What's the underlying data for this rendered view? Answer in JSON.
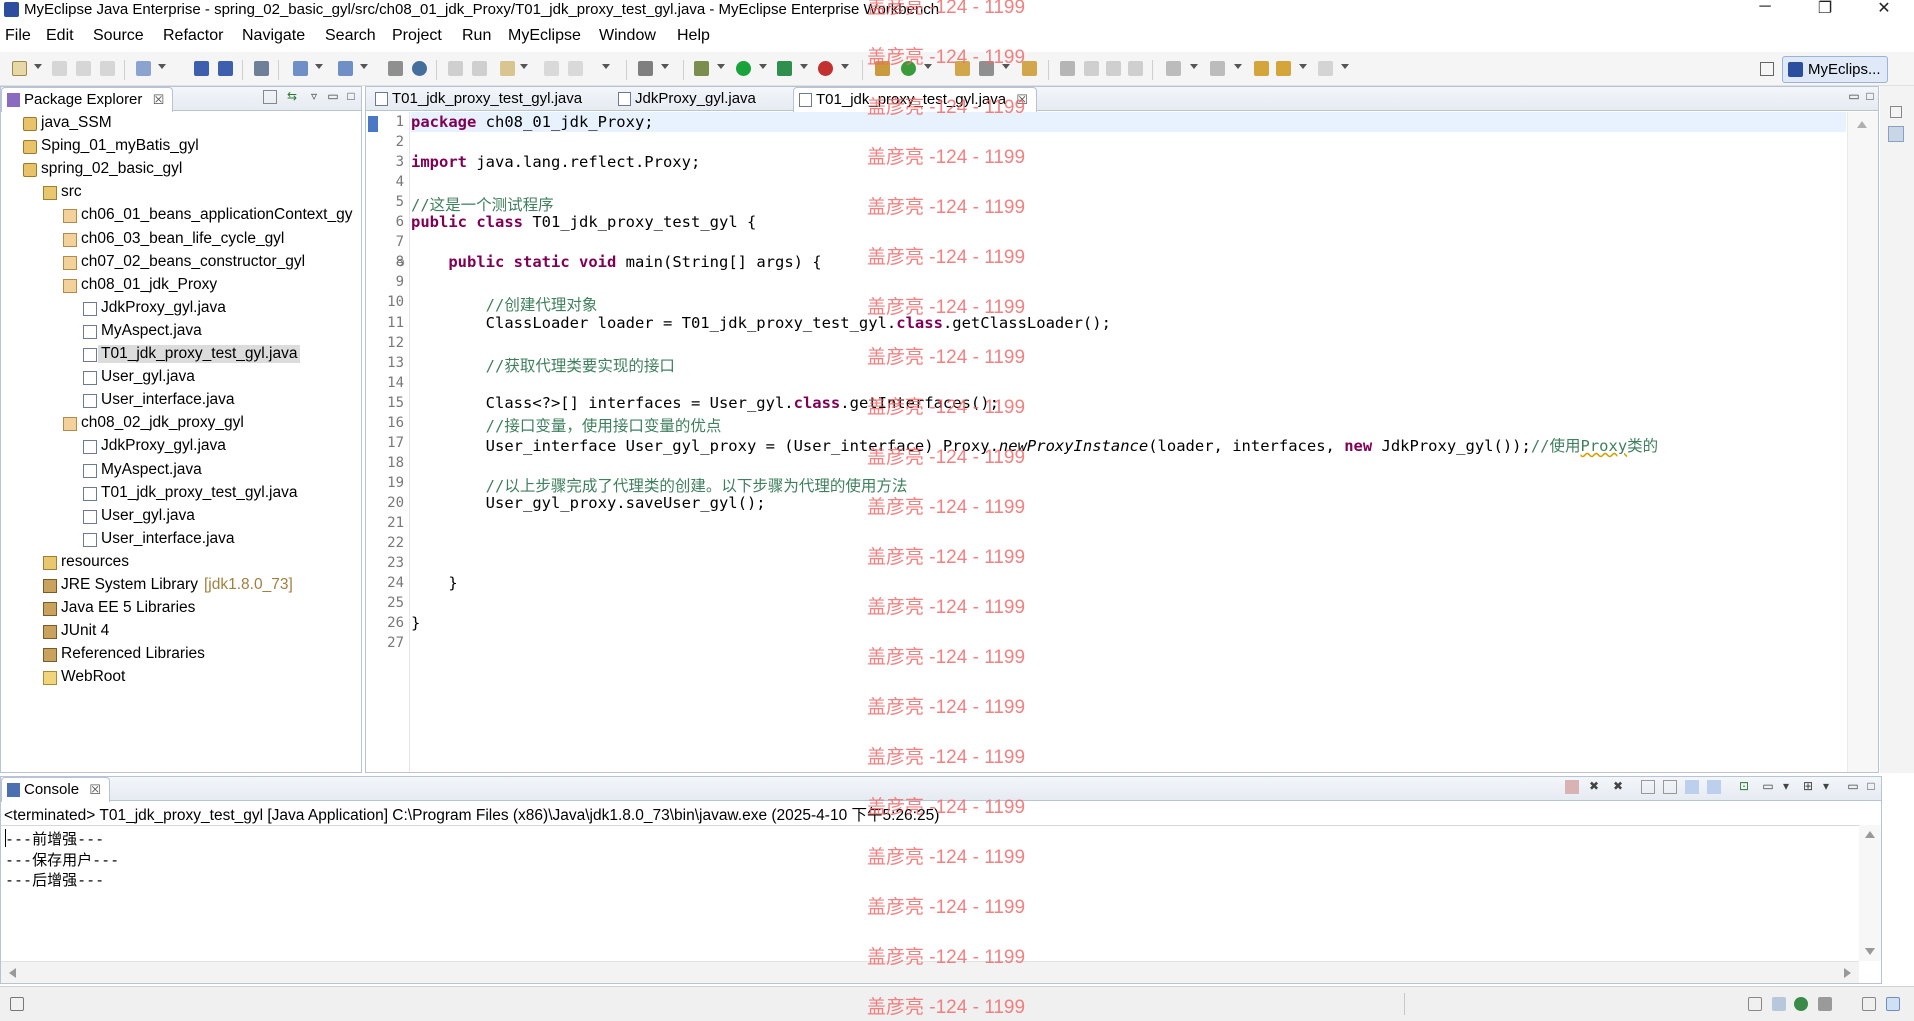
{
  "window": {
    "title": "MyEclipse Java Enterprise - spring_02_basic_gyl/src/ch08_01_jdk_Proxy/T01_jdk_proxy_test_gyl.java - MyEclipse Enterprise Workbench",
    "minimize": "─",
    "restore": "❐",
    "close": "✕"
  },
  "menubar": [
    "File",
    "Edit",
    "Source",
    "Refactor",
    "Navigate",
    "Search",
    "Project",
    "Run",
    "MyEclipse",
    "Window",
    "Help"
  ],
  "perspective": {
    "label": "MyEclips...",
    "icon": "myeclipse-perspective-icon"
  },
  "package_explorer": {
    "title": "Package Explorer",
    "close": "☒",
    "tree": [
      {
        "label": "java_SSM",
        "icon": "project-icon",
        "dec": ""
      },
      {
        "label": "Sping_01_myBatis_gyl",
        "icon": "project-icon",
        "dec": ""
      },
      {
        "label": "spring_02_basic_gyl",
        "icon": "project-icon",
        "dec": ""
      },
      {
        "label": "src",
        "icon": "source-folder-icon",
        "dec": ""
      },
      {
        "label": "ch06_01_beans_applicationContext_gy",
        "icon": "package-icon",
        "dec": ""
      },
      {
        "label": "ch06_03_bean_life_cycle_gyl",
        "icon": "package-icon",
        "dec": ""
      },
      {
        "label": "ch07_02_beans_constructor_gyl",
        "icon": "package-icon",
        "dec": ""
      },
      {
        "label": "ch08_01_jdk_Proxy",
        "icon": "package-icon",
        "dec": ""
      },
      {
        "label": "JdkProxy_gyl.java",
        "icon": "java-file-icon",
        "dec": ""
      },
      {
        "label": "MyAspect.java",
        "icon": "java-file-icon",
        "dec": ""
      },
      {
        "label": "T01_jdk_proxy_test_gyl.java",
        "icon": "java-file-icon",
        "dec": ""
      },
      {
        "label": "User_gyl.java",
        "icon": "java-file-icon",
        "dec": ""
      },
      {
        "label": "User_interface.java",
        "icon": "java-file-icon",
        "dec": ""
      },
      {
        "label": "ch08_02_jdk_proxy_gyl",
        "icon": "package-icon",
        "dec": ""
      },
      {
        "label": "JdkProxy_gyl.java",
        "icon": "java-file-icon",
        "dec": ""
      },
      {
        "label": "MyAspect.java",
        "icon": "java-file-icon",
        "dec": ""
      },
      {
        "label": "T01_jdk_proxy_test_gyl.java",
        "icon": "java-file-icon",
        "dec": ""
      },
      {
        "label": "User_gyl.java",
        "icon": "java-file-icon",
        "dec": ""
      },
      {
        "label": "User_interface.java",
        "icon": "java-file-icon",
        "dec": ""
      },
      {
        "label": "resources",
        "icon": "source-folder-icon",
        "dec": ""
      },
      {
        "label": "JRE System Library",
        "icon": "library-icon",
        "dec": "[jdk1.8.0_73]"
      },
      {
        "label": "Java EE 5 Libraries",
        "icon": "library-icon",
        "dec": ""
      },
      {
        "label": "JUnit 4",
        "icon": "library-icon",
        "dec": ""
      },
      {
        "label": "Referenced Libraries",
        "icon": "library-icon",
        "dec": ""
      },
      {
        "label": "WebRoot",
        "icon": "folder-icon",
        "dec": ""
      }
    ]
  },
  "editor": {
    "tabs": [
      {
        "label": "T01_jdk_proxy_test_gyl.java"
      },
      {
        "label": "JdkProxy_gyl.java"
      },
      {
        "label": "T01_jdk_proxy_test_gyl.java",
        "close": "☒"
      }
    ],
    "line_numbers": [
      "1",
      "2",
      "3",
      "4",
      "5",
      "6",
      "7",
      "8",
      "9",
      "10",
      "11",
      "12",
      "13",
      "14",
      "15",
      "16",
      "17",
      "18",
      "19",
      "20",
      "21",
      "22",
      "23",
      "24",
      "25",
      "26",
      "27"
    ],
    "lines": [
      "<span class=\"kw\">package</span> ch08_01_jdk_Proxy;",
      "",
      "<span class=\"kw\">import</span> java.lang.reflect.Proxy;",
      "",
      "<span class=\"cm\">//这是一个测试程序</span>",
      "<span class=\"kw\">public</span> <span class=\"kw\">class</span> T01_jdk_proxy_test_gyl {",
      "",
      "    <span class=\"kw\">public</span> <span class=\"kw\">static</span> <span class=\"kw\">void</span> main(String[] args) {",
      "",
      "        <span class=\"cm\">//创建代理对象</span>",
      "        ClassLoader loader = T01_jdk_proxy_test_gyl.<span class=\"kw\">class</span>.getClassLoader();",
      "",
      "        <span class=\"cm\">//获取代理类要实现的接口</span>",
      "",
      "        Class&lt;?&gt;[] interfaces = User_gyl.<span class=\"kw\">class</span>.getInterfaces();",
      "        <span class=\"cm\">//接口变量，使用接口变量的优点</span>",
      "        User_interface User_gyl_proxy = (User_interface) Proxy.<span class=\"it\">newProxyInstance</span>(loader, interfaces, <span class=\"kw\">new</span> JdkProxy_gyl());<span class=\"cm\">//使用<span class=\"sq\">Proxy</span>类的</span>",
      "",
      "        <span class=\"cm\">//以上步骤完成了代理类的创建。以下步骤为代理的使用方法</span>",
      "        User_gyl_proxy.saveUser_gyl();",
      "",
      "",
      "",
      "    }",
      "",
      "}",
      ""
    ]
  },
  "console": {
    "title": "Console",
    "close": "☒",
    "status": "<terminated> T01_jdk_proxy_test_gyl [Java Application] C:\\Program Files (x86)\\Java\\jdk1.8.0_73\\bin\\javaw.exe (2025-4-10 下午5:26:25)",
    "output": [
      "---前增强---",
      "---保存用户---",
      "---后增强---"
    ]
  },
  "watermark": {
    "text": "盖彦亮 -124 - 1199",
    "color": "#f06c6c"
  }
}
